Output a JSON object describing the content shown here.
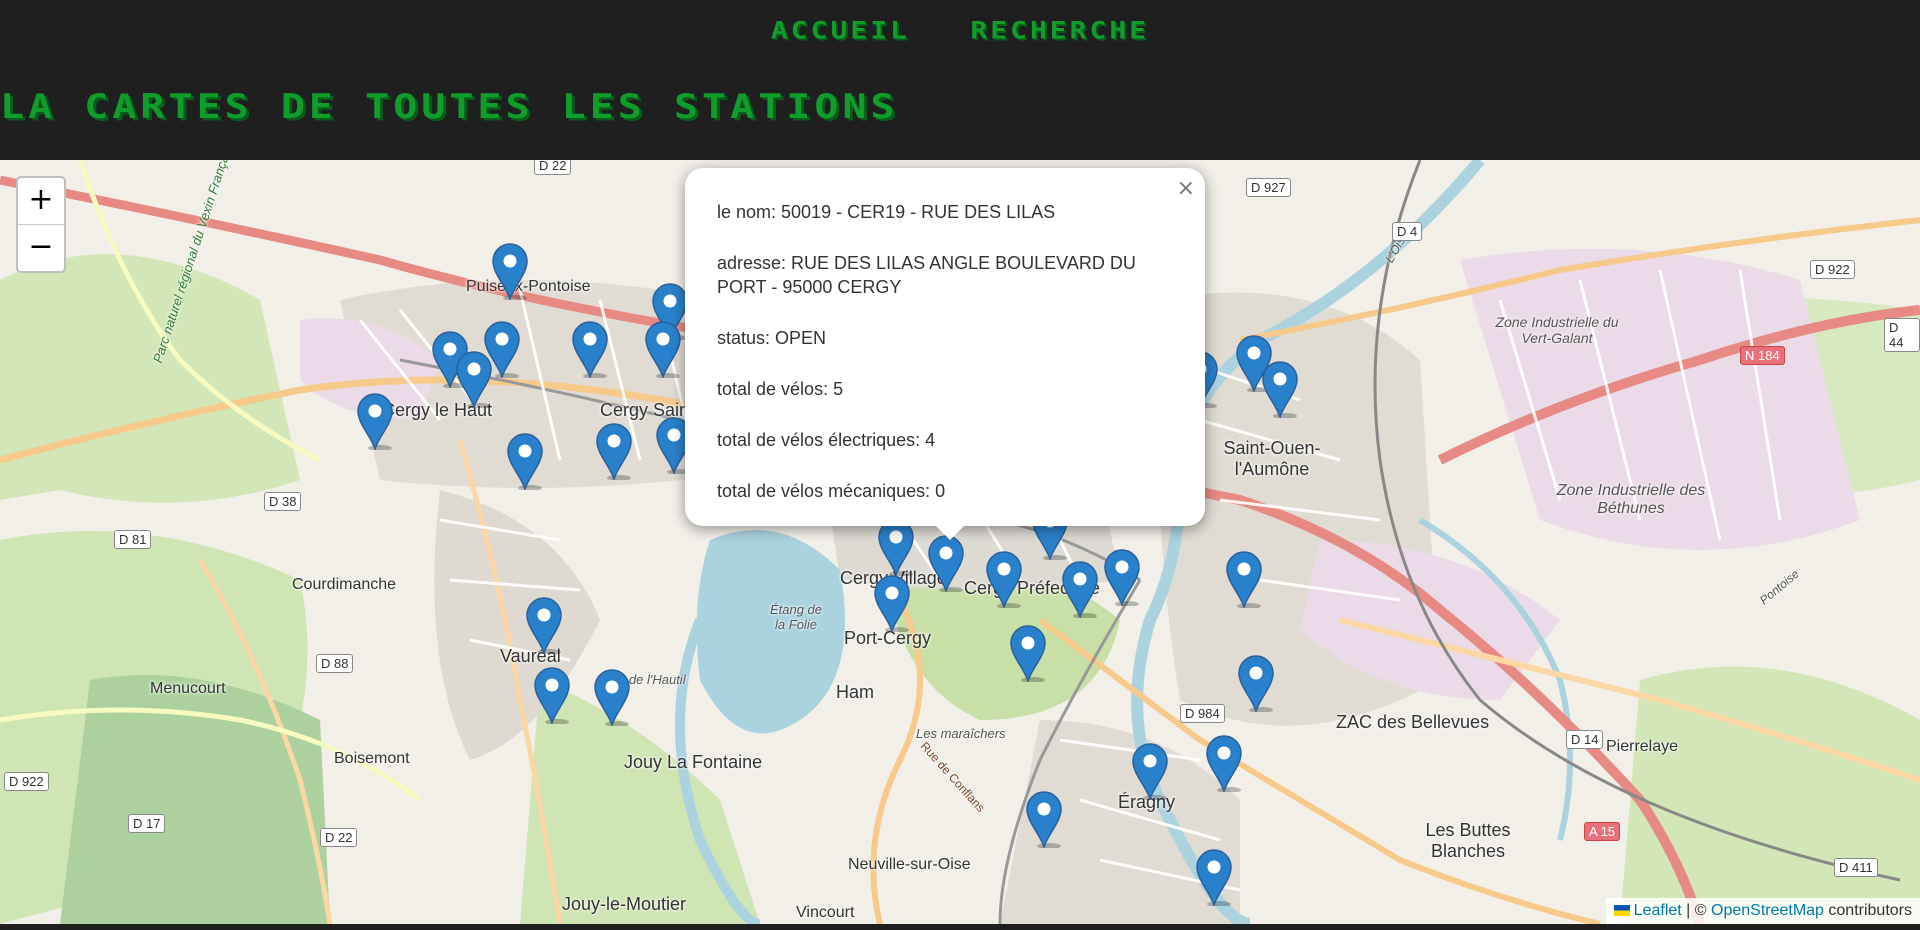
{
  "nav": {
    "home": "ACCUEIL",
    "search": "RECHERCHE"
  },
  "page_title": "LA CARTES DE TOUTES LES STATIONS",
  "zoom": {
    "in": "+",
    "out": "−"
  },
  "popup": {
    "close": "×",
    "name": "le nom: 50019 - CER19 - RUE DES LILAS",
    "address": "adresse: RUE DES LILAS ANGLE BOULEVARD DU PORT - 95000 CERGY",
    "status": "status: OPEN",
    "total_bikes": "total de vélos: 5",
    "electric_bikes": "total de vélos électriques: 4",
    "mechanical_bikes": "total de vélos mécaniques: 0"
  },
  "attribution": {
    "leaflet": "Leaflet",
    "sep": " | © ",
    "osm": "OpenStreetMap",
    "contributors": " contributors"
  },
  "colors": {
    "title_green": "#0f9d2c",
    "marker_blue": "#2a81cb",
    "header_bg": "#1f1f1f"
  },
  "map_labels": {
    "puiseux": "Puiseux-Pontoise",
    "cergy_haut": "Cergy le Haut",
    "cergy_saint": "Cergy Saint",
    "courdimanche": "Courdimanche",
    "vaureal": "Vauréal",
    "menucourt": "Menucourt",
    "boisemont": "Boisemont",
    "jouy_fontaine": "Jouy La Fontaine",
    "jouy_moutier": "Jouy-le-Moutier",
    "vincourt": "Vincourt",
    "neuville": "Neuville-sur-Oise",
    "ham": "Ham",
    "port_cergy": "Port-Cergy",
    "cergy_village": "Cergy Village",
    "cergy_prefecture": "Cergy Préfecture",
    "saint_ouen": "Saint-Ouen-l'Aumône",
    "eragny": "Éragny",
    "zac_bellevues": "ZAC des Bellevues",
    "pierrelaye": "Pierrelaye",
    "buttes_blanches": "Les Buttes Blanches",
    "zone_vert_galant": "Zone Industrielle du Vert-Galant",
    "zone_bethunes": "Zone Industrielle des Béthunes",
    "etang_folie": "Étang de la Folie",
    "bois": "Bois de l'Hautil",
    "maraichers": "Les maraîchers",
    "parc_vexin": "Parc naturel régional du Vexin Français",
    "rue_conflans": "Rue de Conflans",
    "loise": "L'Oise",
    "pontoise": "Pontoise"
  },
  "road_shields": [
    "D 22",
    "D 927",
    "D 4",
    "D 922",
    "N 184",
    "D 44",
    "D 38",
    "D 81",
    "D 88",
    "D 922",
    "D 17",
    "D 22",
    "D 984",
    "D 14",
    "A 15",
    "D 411"
  ]
}
